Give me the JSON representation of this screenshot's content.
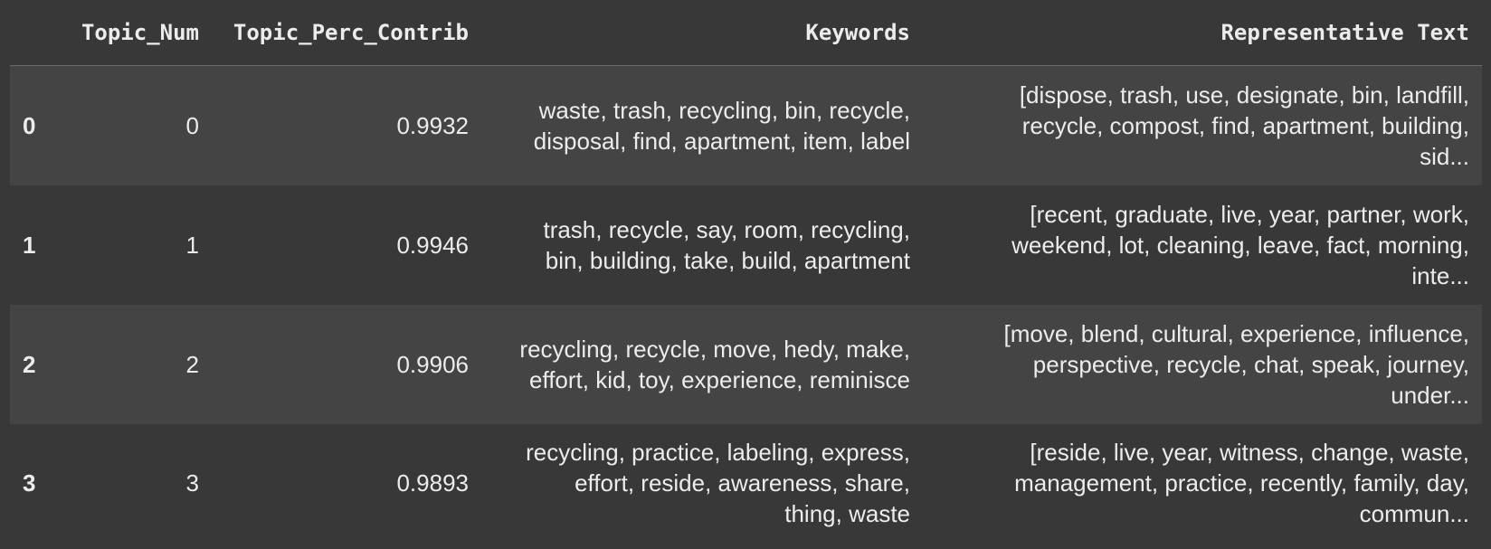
{
  "table": {
    "columns": [
      "",
      "Topic_Num",
      "Topic_Perc_Contrib",
      "Keywords",
      "Representative Text"
    ],
    "rows": [
      {
        "index": "0",
        "topic_num": "0",
        "perc": "0.9932",
        "kw1": "waste, trash, recycling, bin, recycle,",
        "kw2": "disposal, find, apartment, item, label",
        "kw3": "",
        "rep1": "[dispose, trash, use, designate, bin, landfill,",
        "rep2": "recycle, compost, find, apartment, building,",
        "rep3": "sid..."
      },
      {
        "index": "1",
        "topic_num": "1",
        "perc": "0.9946",
        "kw1": "trash, recycle, say, room, recycling,",
        "kw2": "bin, building, take, build, apartment",
        "kw3": "",
        "rep1": "[recent, graduate, live, year, partner, work,",
        "rep2": "weekend, lot, cleaning, leave, fact, morning,",
        "rep3": "inte..."
      },
      {
        "index": "2",
        "topic_num": "2",
        "perc": "0.9906",
        "kw1": "recycling, recycle, move, hedy, make,",
        "kw2": "effort, kid, toy, experience, reminisce",
        "kw3": "",
        "rep1": "[move, blend, cultural, experience, influence,",
        "rep2": "perspective, recycle, chat, speak, journey,",
        "rep3": "under..."
      },
      {
        "index": "3",
        "topic_num": "3",
        "perc": "0.9893",
        "kw1": "recycling, practice, labeling, express,",
        "kw2": "effort, reside, awareness, share,",
        "kw3": "thing, waste",
        "rep1": "[reside, live, year, witness, change, waste,",
        "rep2": "management, practice, recently, family, day,",
        "rep3": "commun..."
      }
    ]
  }
}
